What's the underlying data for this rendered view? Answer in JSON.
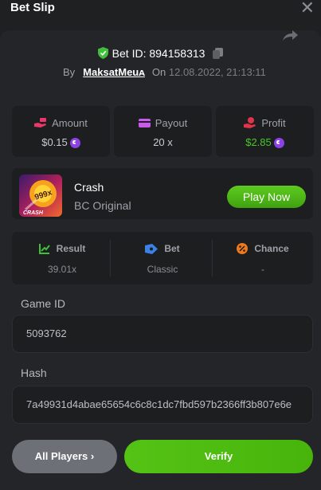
{
  "header": {
    "title": "Bet Slip",
    "close_icon": "close-icon"
  },
  "bet": {
    "id_label": "Bet ID:",
    "id_value": "894158313",
    "by_label": "By",
    "user": "MaksatMeuᴀ",
    "on_label": "On",
    "datetime": "12.08.2022, 21:13:11"
  },
  "stats": {
    "amount": {
      "label": "Amount",
      "value": "$0.15",
      "icon": "money-hand-icon",
      "color": "#e8386c"
    },
    "payout": {
      "label": "Payout",
      "value": "20 x",
      "icon": "wallet-icon",
      "color": "#c85be8"
    },
    "profit": {
      "label": "Profit",
      "value": "$2.85",
      "icon": "hand-coin-icon",
      "color": "#e0344a",
      "value_color": "#48c82a"
    }
  },
  "game": {
    "name": "Crash",
    "provider": "BC Original",
    "thumb_text": "999x",
    "thumb_caption": "CRASH",
    "play_label": "Play Now"
  },
  "results": {
    "result": {
      "label": "Result",
      "value": "39.01x"
    },
    "bet": {
      "label": "Bet",
      "value": "Classic"
    },
    "chance": {
      "label": "Chance",
      "value": "-"
    }
  },
  "fields": {
    "game_id_label": "Game ID",
    "game_id_value": "5093762",
    "hash_label": "Hash",
    "hash_value": "7a49931d4abae65654c6c8c1dc7fbd597b2366ff3b807e6e"
  },
  "buttons": {
    "all_players": "All Players ›",
    "verify": "Verify"
  },
  "colors": {
    "accent_green": "#48b70f",
    "background": "#232528"
  }
}
